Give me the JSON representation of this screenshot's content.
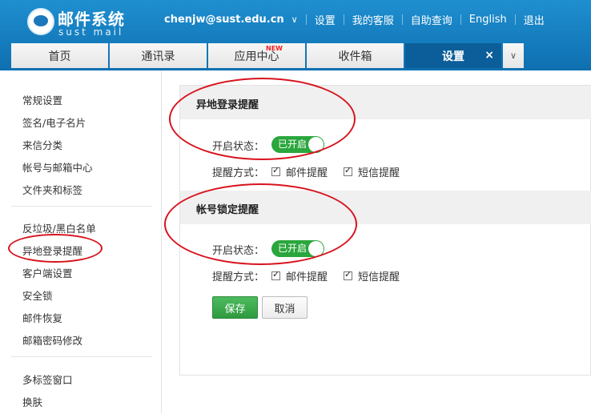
{
  "logo": {
    "title": "邮件系统",
    "subtitle": "sust mail"
  },
  "topnav": {
    "user": "chenjw@sust.edu.cn",
    "links": [
      "设置",
      "我的客服",
      "自助查询",
      "English",
      "退出"
    ]
  },
  "tabs": [
    {
      "label": "首页"
    },
    {
      "label": "通讯录"
    },
    {
      "label": "应用中心",
      "badge": "NEW"
    },
    {
      "label": "收件箱"
    },
    {
      "label": "设置",
      "close": "×"
    }
  ],
  "sidebar": {
    "group1": [
      "常规设置",
      "签名/电子名片",
      "来信分类",
      "帐号与邮箱中心",
      "文件夹和标签"
    ],
    "group2": [
      "反垃圾/黑白名单",
      "异地登录提醒",
      "客户端设置",
      "安全锁",
      "邮件恢复",
      "邮箱密码修改"
    ],
    "group3": [
      "多标签窗口",
      "换肤"
    ]
  },
  "sections": [
    {
      "title": "异地登录提醒",
      "status_label": "开启状态：",
      "toggle_text": "已开启",
      "method_label": "提醒方式：",
      "options": [
        "邮件提醒",
        "短信提醒"
      ]
    },
    {
      "title": "帐号锁定提醒",
      "status_label": "开启状态：",
      "toggle_text": "已开启",
      "method_label": "提醒方式：",
      "options": [
        "邮件提醒",
        "短信提醒"
      ]
    }
  ],
  "buttons": {
    "save": "保存",
    "cancel": "取消"
  },
  "colors": {
    "header": "#1580c2",
    "active_tab": "#0b5e99",
    "toggle_on": "#2aa63d",
    "annotation": "#d8131e"
  }
}
